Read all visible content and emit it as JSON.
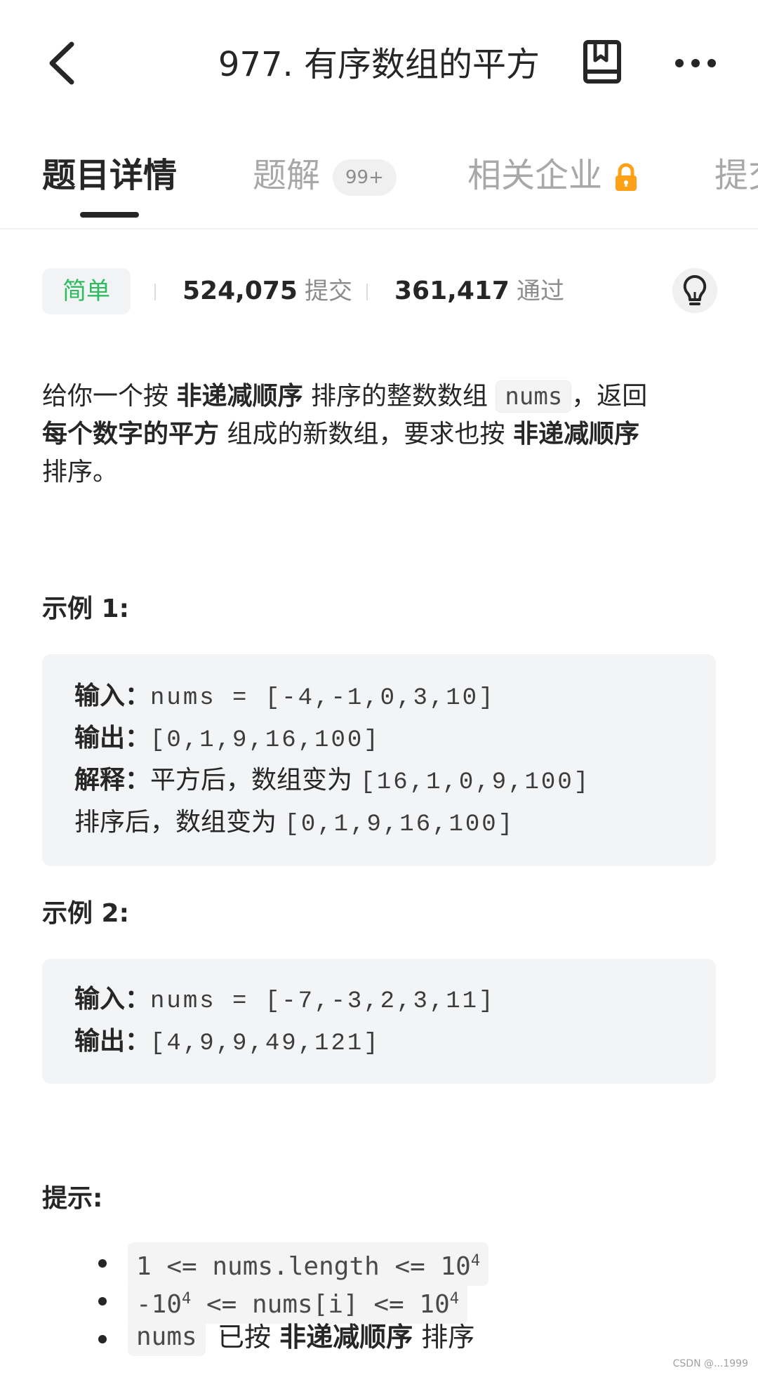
{
  "header": {
    "title": "977. 有序数组的平方"
  },
  "tabs": [
    {
      "label": "题目详情",
      "active": true
    },
    {
      "label": "题解",
      "badge": "99+"
    },
    {
      "label": "相关企业",
      "locked": true
    },
    {
      "label": "提交"
    }
  ],
  "stats": {
    "difficulty": "简单",
    "submissions_value": "524,075",
    "submissions_label": "提交",
    "accepted_value": "361,417",
    "accepted_label": "通过"
  },
  "description": {
    "p1": "给你一个按",
    "b1": "非递减顺序",
    "p2": "排序的整数数组",
    "code1": "nums",
    "p3": "，返回",
    "b2": "每个数字的平方",
    "p4": "组成的新数组，要求也按",
    "b3": "非递减顺序",
    "p5": "排序。"
  },
  "examples": [
    {
      "title": "示例 1:",
      "input_label": "输入：",
      "input_value": "nums = [-4,-1,0,3,10]",
      "output_label": "输出：",
      "output_value": "[0,1,9,16,100]",
      "explain_label": "解释：",
      "explain_text": "平方后，数组变为",
      "explain_value": "[16,1,0,9,100]",
      "explain_text2": "排序后，数组变为",
      "explain_value2": "[0,1,9,16,100]"
    },
    {
      "title": "示例 2:",
      "input_label": "输入：",
      "input_value": "nums = [-7,-3,2,3,11]",
      "output_label": "输出：",
      "output_value": "[4,9,9,49,121]"
    }
  ],
  "hints": {
    "title": "提示:",
    "c1_pre": "1 <= nums.length <= 10",
    "c1_exp": "4",
    "c2_pre": "-10",
    "c2_exp1": "4",
    "c2_mid": " <= nums[i] <= 10",
    "c2_exp2": "4",
    "c3_code": "nums",
    "c3_text1": "已按",
    "c3_bold": "非递减顺序",
    "c3_text2": "排序"
  },
  "watermark": "CSDN @...1999",
  "colors": {
    "easy": "#2cbb5d",
    "lock": "#ffa116",
    "text": "#262626",
    "muted": "#a8a8a8"
  }
}
